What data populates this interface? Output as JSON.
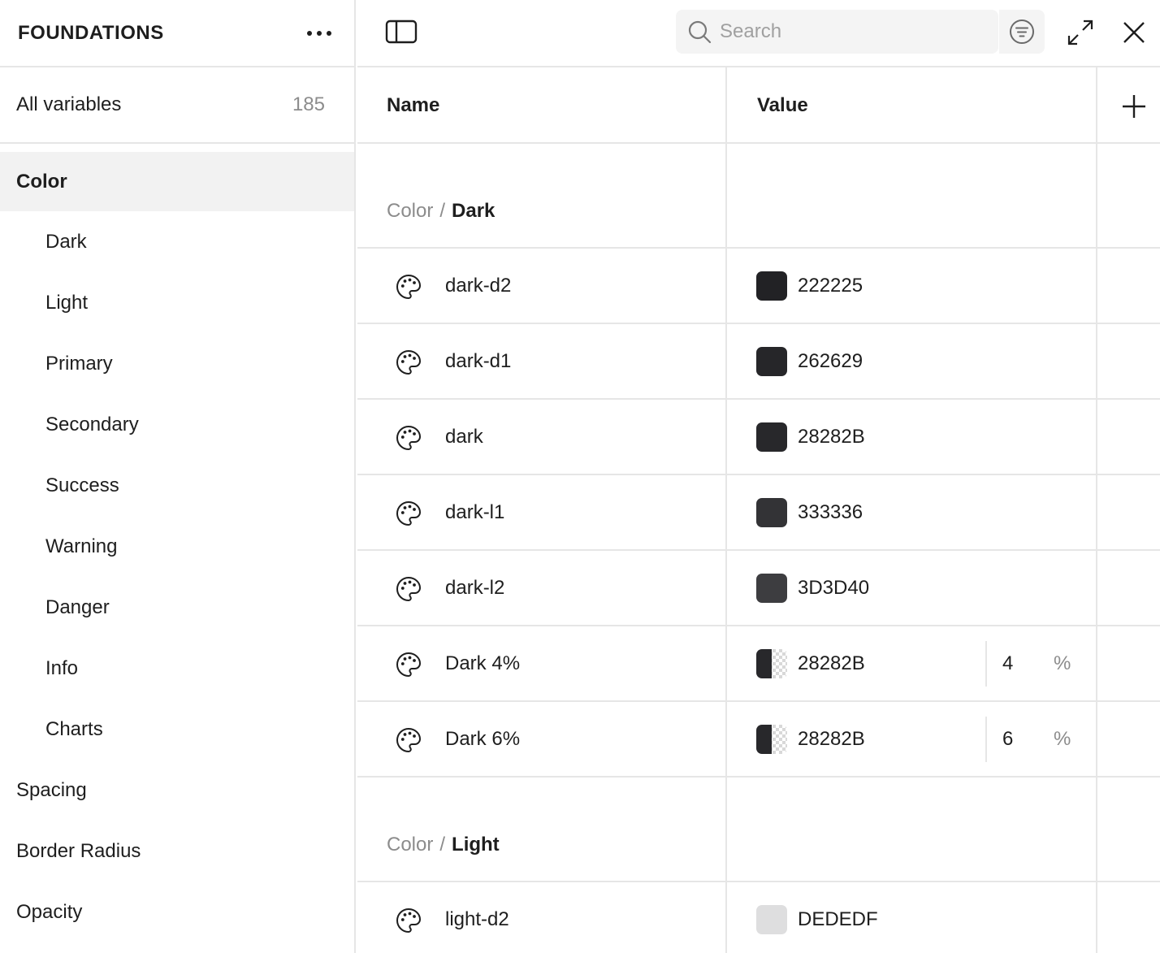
{
  "sidebar": {
    "title": "FOUNDATIONS",
    "all_variables": {
      "label": "All variables",
      "count": "185"
    },
    "items": [
      {
        "label": "Color",
        "level": 0,
        "active": true
      },
      {
        "label": "Dark",
        "level": 1
      },
      {
        "label": "Light",
        "level": 1
      },
      {
        "label": "Primary",
        "level": 1
      },
      {
        "label": "Secondary",
        "level": 1
      },
      {
        "label": "Success",
        "level": 1
      },
      {
        "label": "Warning",
        "level": 1
      },
      {
        "label": "Danger",
        "level": 1
      },
      {
        "label": "Info",
        "level": 1
      },
      {
        "label": "Charts",
        "level": 1
      },
      {
        "label": "Spacing",
        "level": 0
      },
      {
        "label": "Border Radius",
        "level": 0
      },
      {
        "label": "Opacity",
        "level": 0
      }
    ]
  },
  "toolbar": {
    "search_placeholder": "Search",
    "icons": [
      "panel-toggle-icon",
      "search-icon",
      "filter-icon",
      "expand-icon",
      "close-icon"
    ]
  },
  "table": {
    "columns": {
      "name": "Name",
      "value": "Value"
    },
    "groups": [
      {
        "path": "Color",
        "separator": "/",
        "name": "Dark",
        "rows": [
          {
            "name": "dark-d2",
            "hex": "222225",
            "color": "#222225"
          },
          {
            "name": "dark-d1",
            "hex": "262629",
            "color": "#262629"
          },
          {
            "name": "dark",
            "hex": "28282B",
            "color": "#28282B"
          },
          {
            "name": "dark-l1",
            "hex": "333336",
            "color": "#333336"
          },
          {
            "name": "dark-l2",
            "hex": "3D3D40",
            "color": "#3D3D40"
          },
          {
            "name": "Dark 4%",
            "hex": "28282B",
            "color": "#28282B",
            "opacity": "4",
            "unit": "%"
          },
          {
            "name": "Dark 6%",
            "hex": "28282B",
            "color": "#28282B",
            "opacity": "6",
            "unit": "%"
          }
        ]
      },
      {
        "path": "Color",
        "separator": "/",
        "name": "Light",
        "rows": [
          {
            "name": "light-d2",
            "hex": "DEDEDF",
            "color": "#DEDEDF"
          }
        ]
      }
    ]
  }
}
